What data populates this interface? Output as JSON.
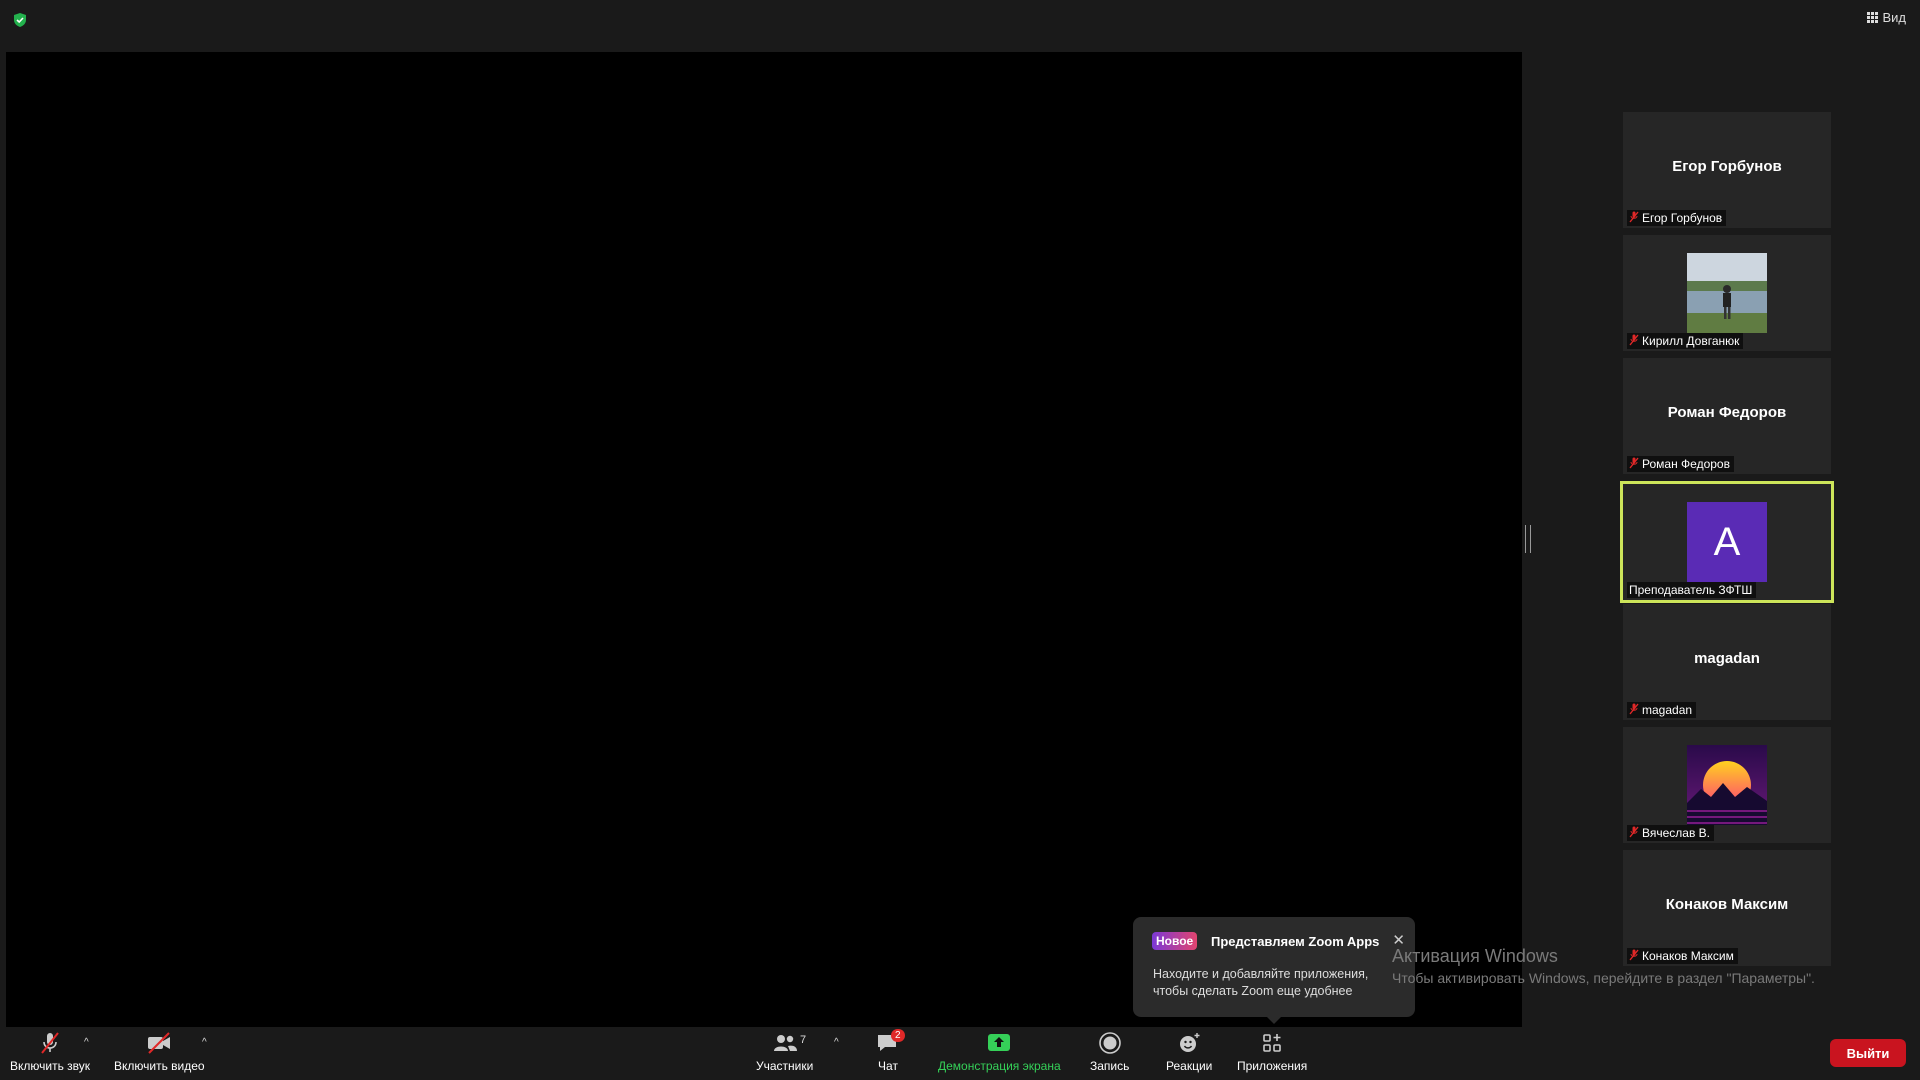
{
  "topbar": {
    "view_label": "Вид"
  },
  "participants_gallery": [
    {
      "display": "Егор Горбунов",
      "label": "Егор Горбунов",
      "muted": true,
      "type": "name"
    },
    {
      "display": "",
      "label": "Кирилл Довганюк",
      "muted": true,
      "type": "photo-lake"
    },
    {
      "display": "Роман Федоров",
      "label": "Роман Федоров",
      "muted": true,
      "type": "name"
    },
    {
      "display": "A",
      "label": "Преподаватель ЗФТШ",
      "muted": false,
      "type": "avatar",
      "active": true
    },
    {
      "display": "magadan",
      "label": "magadan",
      "muted": true,
      "type": "name"
    },
    {
      "display": "",
      "label": "Вячеслав В.",
      "muted": true,
      "type": "photo-sunset"
    },
    {
      "display": "Конаков Максим",
      "label": "Конаков Максим",
      "muted": true,
      "type": "name"
    }
  ],
  "toolbar": {
    "audio_label": "Включить звук",
    "video_label": "Включить видео",
    "participants_label": "Участники",
    "participants_count": "7",
    "chat_label": "Чат",
    "chat_badge": "2",
    "share_label": "Демонстрация экрана",
    "record_label": "Запись",
    "reactions_label": "Реакции",
    "apps_label": "Приложения",
    "leave_label": "Выйти"
  },
  "popup": {
    "tag": "Новое",
    "title": "Представляем Zoom Apps",
    "body": "Находите и добавляйте приложения, чтобы сделать Zoom еще удобнее"
  },
  "watermark": {
    "line1": "Активация Windows",
    "line2": "Чтобы активировать Windows, перейдите в раздел \"Параметры\"."
  },
  "colors": {
    "active_speaker_border": "#cde55a",
    "share_green": "#35d058",
    "leave_red": "#c9141f",
    "avatar_purple": "#5a2bb5"
  }
}
